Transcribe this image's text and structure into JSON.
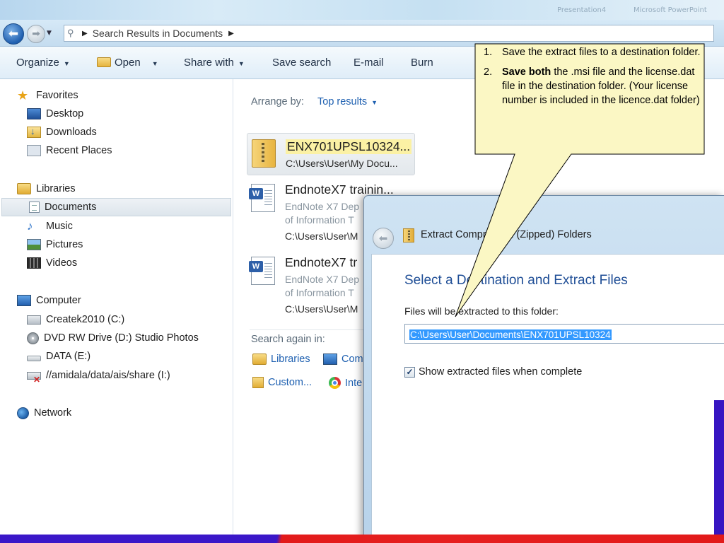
{
  "titlebar": {
    "ghost_items": [
      "Presentation4",
      "Microsoft PowerPoint"
    ]
  },
  "address": {
    "crumb": "Search Results in Documents"
  },
  "toolbar": {
    "organize": "Organize",
    "open": "Open",
    "share_with": "Share with",
    "save_search": "Save search",
    "email": "E-mail",
    "burn": "Burn"
  },
  "nav": {
    "favorites": {
      "label": "Favorites",
      "items": [
        "Desktop",
        "Downloads",
        "Recent Places"
      ]
    },
    "libraries": {
      "label": "Libraries",
      "items": [
        "Documents",
        "Music",
        "Pictures",
        "Videos"
      ],
      "selected": "Documents"
    },
    "computer": {
      "label": "Computer",
      "items": [
        "Createk2010 (C:)",
        "DVD RW Drive (D:) Studio Photos",
        "DATA (E:)",
        "//amidala/data/ais/share (I:)"
      ]
    },
    "network": {
      "label": "Network"
    }
  },
  "results": {
    "arrange_label": "Arrange by:",
    "arrange_value": "Top results",
    "items": [
      {
        "name": "ENX701UPSL10324...",
        "line1": "C:\\Users\\User\\My Docu...",
        "line2": "",
        "line3": "",
        "icon": "zip-folder-icon"
      },
      {
        "name": "EndnoteX7 trainin...",
        "line1": "EndNote X7 Dep",
        "line2": "of Information T",
        "line3": "C:\\Users\\User\\M",
        "icon": "word-doc-icon"
      },
      {
        "name": "EndnoteX7 tr",
        "line1": "EndNote X7 Dep",
        "line2": "of Information T",
        "line3": "C:\\Users\\User\\M",
        "icon": "word-doc-icon"
      }
    ],
    "search_again": {
      "label": "Search again in:",
      "links": [
        "Libraries",
        "Com",
        "Custom...",
        "Inte"
      ]
    }
  },
  "dialog": {
    "title": "Extract Compressed (Zipped) Folders",
    "heading": "Select a Destination and Extract Files",
    "folder_label": "Files will be extracted to this folder:",
    "folder_value": "C:\\Users\\User\\Documents\\ENX701UPSL10324",
    "show_checkbox_label": "Show extracted files when complete",
    "show_checked": true
  },
  "callout": {
    "item1_num": "1.",
    "item1_text": "Save the extract files to a destination folder.",
    "item2_num": "2.",
    "item2_bold": "Save both",
    "item2_text": " the .msi file and the license.dat file in the destination folder. (Your license number is included in the licence.dat folder)",
    "fill_color": "#fbf7c4",
    "border_color": "#000000"
  },
  "colors": {
    "link_blue": "#1d5fb0",
    "dialog_heading": "#1f4e96",
    "selection_blue": "#3399ff",
    "slide_blue": "#3a17c8",
    "slide_red": "#e21a1a"
  }
}
